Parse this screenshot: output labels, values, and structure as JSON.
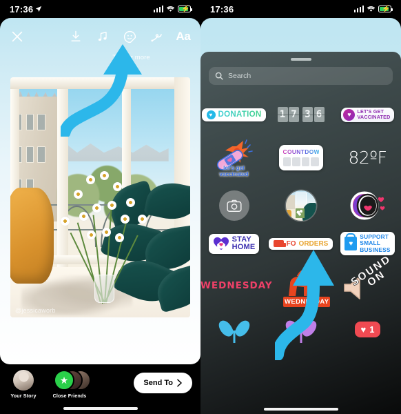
{
  "meta": {
    "app": "Instagram Story Editor",
    "panels": 2
  },
  "status_bar": {
    "time": "17:36",
    "location_arrow": "location-arrow-icon",
    "signal": "signal-bars-icon",
    "wifi": "wifi-icon",
    "battery": "battery-charging-icon"
  },
  "left_panel": {
    "close_label": "×",
    "close_icon": "close-icon",
    "tools": [
      {
        "name": "download-icon",
        "label": "Download"
      },
      {
        "name": "music-note-icon",
        "label": "Music"
      },
      {
        "name": "sticker-smiley-icon",
        "label": "Stickers"
      },
      {
        "name": "draw-squiggle-icon",
        "label": "Draw"
      },
      {
        "name": "text-aa-icon",
        "label": "Aa"
      }
    ],
    "hint_text": "Tap for more",
    "photo": {
      "alt": "Open window with daisies in a vase, Paris rooftops, yellow pillow and green plant",
      "watermark": "@jessicaworb"
    },
    "bottom": {
      "audiences": [
        {
          "label": "Your Story",
          "avatar": "your-story-avatar"
        },
        {
          "label": "Close Friends",
          "avatar": "close-friends-avatars"
        }
      ],
      "send_label": "Send To",
      "send_chevron": "chevron-right-icon"
    },
    "annotation": {
      "arrow": "curved-arrow-up-right",
      "color": "#2cb7ea"
    }
  },
  "right_panel": {
    "search": {
      "placeholder": "Search",
      "icon": "search-icon"
    },
    "grabber": "drag-handle",
    "stickers": [
      {
        "row": 1,
        "items": [
          {
            "name": "donation-sticker",
            "label": "DONATION",
            "icon": "heart-icon"
          },
          {
            "name": "clock-sticker",
            "label": "1736",
            "digits": [
              "1",
              "7",
              "3",
              "6"
            ]
          },
          {
            "name": "lets-get-vaccinated-pill-sticker",
            "label": "LET'S GET VACCINATED",
            "line1": "LET'S GET",
            "line2": "VACCINATED"
          }
        ]
      },
      {
        "row": 2,
        "items": [
          {
            "name": "vaccinated-flower-bandaid-sticker",
            "label": "let's get vaccinated",
            "line1": "let's get",
            "line2": "vaccinated"
          },
          {
            "name": "countdown-sticker",
            "label": "COUNTDOWN"
          },
          {
            "name": "temperature-sticker",
            "label": "82ºF"
          }
        ]
      },
      {
        "row": 3,
        "items": [
          {
            "name": "camera-sticker",
            "label": "Camera",
            "icon": "camera-icon"
          },
          {
            "name": "photo-sticker",
            "label": "Photo"
          },
          {
            "name": "mouth-hearts-sticker",
            "label": "Mouth with hearts"
          }
        ]
      },
      {
        "row": 4,
        "items": [
          {
            "name": "stay-home-sticker",
            "label": "STAY HOME",
            "line1": "STAY",
            "line2": "HOME"
          },
          {
            "name": "food-orders-sticker",
            "label": "FOOD ORDERS",
            "part1": "FO",
            "part2": "ORDERS"
          },
          {
            "name": "support-small-business-sticker",
            "label": "SUPPORT SMALL BUSINESS",
            "line1": "SUPPORT",
            "line2": "SMALL",
            "line3": "BUSINESS"
          }
        ]
      },
      {
        "row": 5,
        "items": [
          {
            "name": "wednesday-text-sticker",
            "label": "WEDNESDAY"
          },
          {
            "name": "camel-wednesday-sticker",
            "label": "WEDNESDAY"
          },
          {
            "name": "sound-on-sticker",
            "label": "SOUND ON",
            "line1": "SOUND",
            "line2": "ON"
          }
        ]
      },
      {
        "row": 6,
        "items": [
          {
            "name": "blue-butterfly-sticker",
            "label": "Blue butterfly"
          },
          {
            "name": "purple-butterfly-sticker",
            "label": "Purple butterfly"
          },
          {
            "name": "like-count-sticker",
            "label": "1",
            "icon": "heart-icon"
          }
        ]
      }
    ],
    "annotation": {
      "arrow": "curved-arrow-up",
      "color": "#2cb7ea"
    }
  },
  "colors": {
    "accent_arrow": "#2cb7ea",
    "tray_top": "#4d5a5c",
    "tray_bottom": "#090a0a",
    "story_sky": "#cdeaf4",
    "send_bg": "#ffffff",
    "close_friends_green": "#2ad04a",
    "like_red": "#f04a52"
  }
}
